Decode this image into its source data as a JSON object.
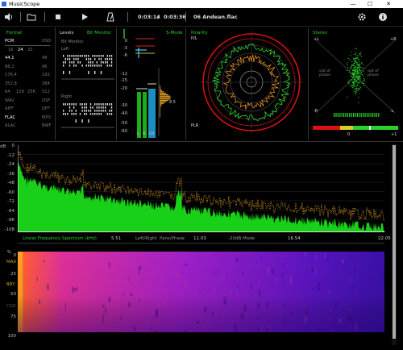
{
  "app": {
    "title": "MusicScope"
  },
  "window": {
    "minimize": "—",
    "maximize": "☐",
    "close": "✕"
  },
  "toolbar": {
    "current_time": "0:03:14",
    "divider": "/",
    "total_time": "0:03:36",
    "track": "06 Andean.flac",
    "icons": [
      "volume-icon",
      "folder-icon",
      "stop-icon",
      "play-icon",
      "metronome-icon",
      "gear-icon",
      "info-icon"
    ]
  },
  "format_panel": {
    "title": "Format",
    "rows": [
      [
        "PCM",
        "",
        "",
        "DSD"
      ],
      [
        "16",
        "24",
        "32",
        ""
      ],
      [
        "44.1",
        "",
        "",
        "48"
      ],
      [
        "88.2",
        "",
        "",
        "96"
      ],
      [
        "176.4",
        "",
        "",
        "192"
      ],
      [
        "352.8",
        "",
        "",
        "384"
      ],
      [
        "64",
        "128",
        "256",
        "512"
      ],
      [
        "WAV",
        "",
        "",
        "DSF"
      ],
      [
        "AIFF",
        "",
        "",
        "DFF"
      ],
      [
        "FLAC",
        "",
        "",
        "MP3"
      ],
      [
        "ALAC",
        "",
        "",
        "BWF"
      ]
    ],
    "active": [
      "PCM",
      "24",
      "44.1",
      "FLAC"
    ]
  },
  "levels_panel": {
    "title": "Levels",
    "bitmonitor_tab": "Bit Monitor",
    "subtitle": "Bit Monitor",
    "left": "Left",
    "right": "Right"
  },
  "meter_panel": {
    "smode": "S-Mode",
    "scale": [
      "0",
      "-3",
      "-6",
      "-12",
      "-15",
      "-20",
      "-30",
      "-40",
      "-50",
      "-60"
    ],
    "peak_value": "8.5",
    "channel_labels": [
      "L",
      "R",
      "LU"
    ]
  },
  "polarity_panel": {
    "title": "Polarity",
    "pl_label": "P/L",
    "plr_label": "PLR"
  },
  "stereo_panel": {
    "title": "Stereo",
    "plus_l": "+L",
    "plus_r": "+R",
    "minus_l": "-L",
    "minus_r": "-R",
    "out_phase_left": "out of phase",
    "out_phase_right": "out of phase",
    "scale_zero": "0",
    "scale_plus": "+1"
  },
  "spectrum": {
    "y_ticks": [
      "0",
      "-12",
      "-24",
      "-36",
      "-48",
      "-60",
      "-72",
      "-84",
      "-96",
      "-108"
    ],
    "y_unit": "dB",
    "x_ticks": [
      "5.51",
      "11.03",
      "16.54",
      "22.05"
    ],
    "title": "Linear Frequency Spectrum (kHz)",
    "mode_labels": [
      "Left/Right",
      "Pans/Phase",
      "-20dB Mode"
    ],
    "accent": "#19d019",
    "peak_color": "#e3a020"
  },
  "spectrogram": {
    "y_ticks": [
      "%",
      "0",
      "25",
      "50",
      "75",
      "100"
    ],
    "labels": [
      "MAX",
      "BRY",
      "CGE"
    ]
  }
}
